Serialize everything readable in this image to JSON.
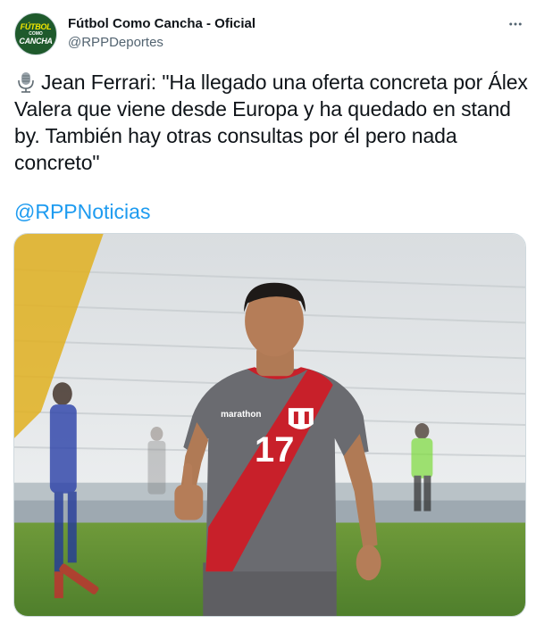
{
  "author": {
    "display_name": "Fútbol Como Cancha - Oficial",
    "handle": "@RPPDeportes",
    "avatar": {
      "line1": "FÚTBOL",
      "line2": "COMO",
      "line3": "CANCHA"
    }
  },
  "tweet": {
    "text": "Jean Ferrari: \"Ha llegado una oferta concreta por Álex Valera que viene desde Europa y ha quedado en stand by. También hay otras consultas por él pero nada concreto\"",
    "mention": "@RPPNoticias",
    "lead_icon": "microphone-icon"
  },
  "media": {
    "jersey_brand": "marathon",
    "jersey_number": "17"
  },
  "colors": {
    "link": "#1d9bf0",
    "secondary_text": "#536471",
    "primary_text": "#0f1419"
  }
}
